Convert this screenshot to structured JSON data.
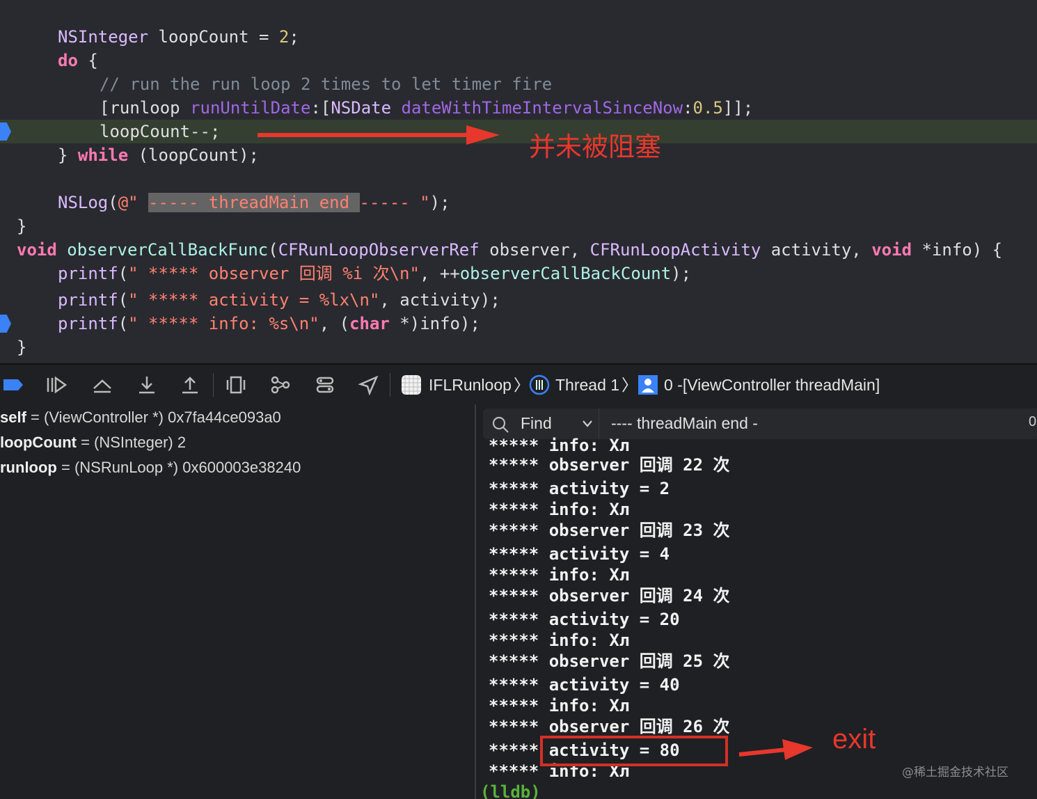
{
  "editor": {
    "line1": {
      "ty": "NSInteger",
      "a": " loopCount = ",
      "num": "2",
      "b": ";"
    },
    "line2": {
      "kw": "do",
      "a": " {"
    },
    "line3": {
      "comment": "// run the run loop 2 times to let timer fire"
    },
    "line4": {
      "a": "[runloop ",
      "m1": "runUntilDate",
      "b": ":[",
      "cls": "NSDate",
      "c": " ",
      "m2": "dateWithTimeIntervalSinceNow",
      "d": ":",
      "num": "0.5",
      "e": "]];"
    },
    "line5": {
      "a": "loopCount--;"
    },
    "line6": {
      "a": "} ",
      "kw": "while",
      "b": " (loopCount);"
    },
    "line8": {
      "fn": "NSLog",
      "a": "(",
      "str1": "@\" ",
      "sel": "----- threadMain end ",
      "str2": "----- \"",
      "b": ");"
    },
    "line9": {
      "a": "}"
    },
    "line10": {
      "kw1": "void",
      "fn": " observerCallBackFunc",
      "a": "(",
      "ty1": "CFRunLoopObserverRef",
      "b": " observer, ",
      "ty2": "CFRunLoopActivity",
      "c": " activity, ",
      "kw2": "void",
      "d": " *info) {"
    },
    "line11": {
      "fn": "printf",
      "a": "(",
      "str": "\" ***** observer 回调 %i 次\\n\"",
      "b": ", ++",
      "var": "observerCallBackCount",
      "c": ");"
    },
    "line12": {
      "fn": "printf",
      "a": "(",
      "str": "\" ***** activity = %lx\\n\"",
      "b": ", activity);"
    },
    "line13": {
      "fn": "printf",
      "a": "(",
      "str": "\" ***** info: %s\\n\"",
      "b": ", (",
      "kw": "char",
      "c": " *)info);"
    },
    "line14": {
      "a": "}"
    }
  },
  "annotation_top": "并未被阻塞",
  "breadcrumb": {
    "app": "IFLRunloop",
    "thread": "Thread 1",
    "frame": "0 -[ViewController threadMain]"
  },
  "variables": [
    {
      "name": "self",
      "value": " = (ViewController *) 0x7fa44ce093a0"
    },
    {
      "name": "loopCount",
      "value": " = (NSInteger) 2"
    },
    {
      "name": "runloop",
      "value": " = (NSRunLoop *) 0x600003e38240"
    }
  ],
  "find": {
    "label": "Find",
    "query": "---- threadMain end -",
    "count": "0"
  },
  "console_lines": [
    "***** info: Xл",
    "***** observer 回调 22 次",
    "***** activity = 2",
    "***** info: Xл",
    "***** observer 回调 23 次",
    "***** activity = 4",
    "***** info: Xл",
    "***** observer 回调 24 次",
    "***** activity = 20",
    "***** info: Xл",
    "***** observer 回调 25 次",
    "***** activity = 40",
    "***** info: Xл",
    "***** observer 回调 26 次",
    "***** activity = 80",
    "***** info: Xл"
  ],
  "prompt": "(lldb)",
  "annotation_exit": "exit",
  "watermark": "@稀土掘金技术社区",
  "colors": {
    "accent_red": "#e8372c",
    "breakpoint": "#3a82f6",
    "lldb": "#57b33a"
  }
}
